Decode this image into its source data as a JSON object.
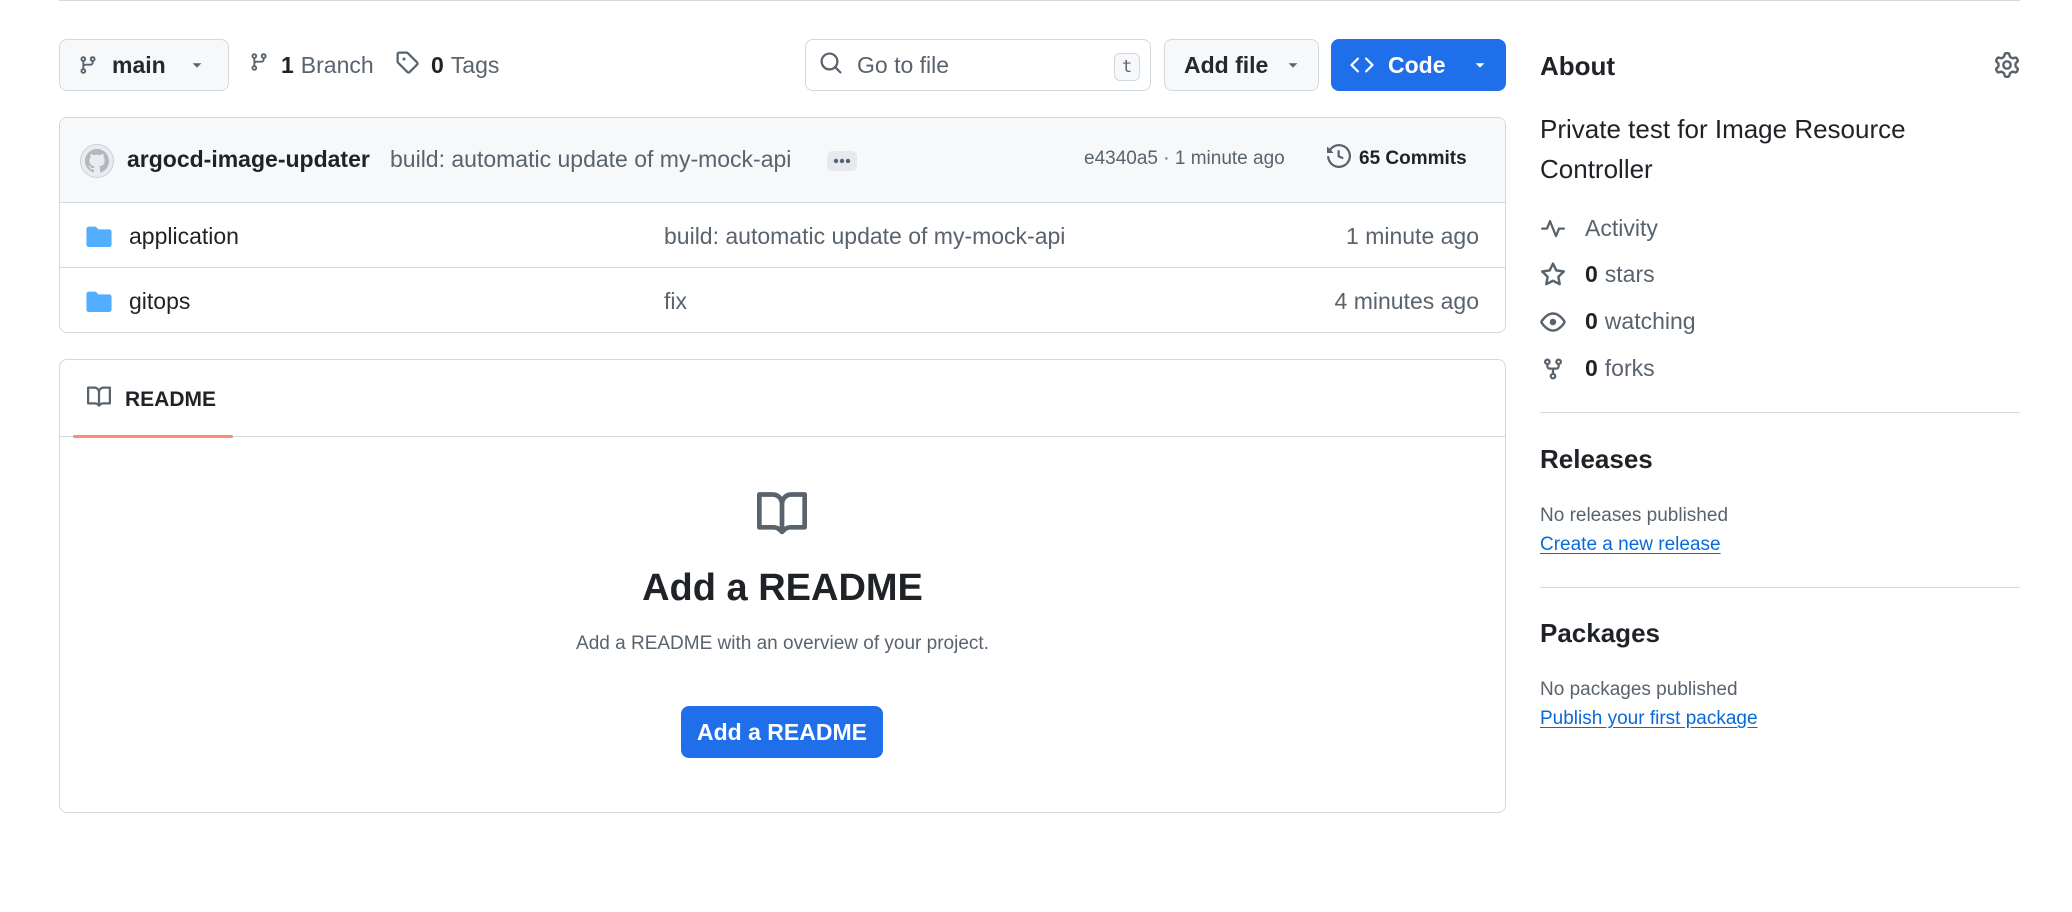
{
  "toolbar": {
    "branch": "main",
    "branch_count": "1",
    "branch_label": "Branch",
    "tag_count": "0",
    "tag_label": "Tags",
    "search_placeholder": "Go to file",
    "search_shortcut": "t",
    "add_file": "Add file",
    "code": "Code"
  },
  "commit": {
    "author": "argocd-image-updater",
    "message": "build: automatic update of my-mock-api",
    "sha_time": "e4340a5 · 1 minute ago",
    "commits": "65 Commits"
  },
  "files": [
    {
      "name": "application",
      "message": "build: automatic update of my-mock-api",
      "time": "1 minute ago"
    },
    {
      "name": "gitops",
      "message": "fix",
      "time": "4 minutes ago"
    }
  ],
  "readme": {
    "tab": "README",
    "title": "Add a README",
    "subtitle": "Add a README with an overview of your project.",
    "button": "Add a README"
  },
  "about": {
    "title": "About",
    "description": "Private test for Image Resource Controller",
    "activity": "Activity",
    "stars_count": "0",
    "stars_label": "stars",
    "watching_count": "0",
    "watching_label": "watching",
    "forks_count": "0",
    "forks_label": "forks"
  },
  "releases": {
    "title": "Releases",
    "note": "No releases published",
    "link": "Create a new release"
  },
  "packages": {
    "title": "Packages",
    "note": "No packages published",
    "link": "Publish your first package"
  },
  "colors": {
    "primary_button": "#1f6feb",
    "folder": "#54aeff",
    "link": "#0969da",
    "tab_underline": "#fd8c73"
  }
}
